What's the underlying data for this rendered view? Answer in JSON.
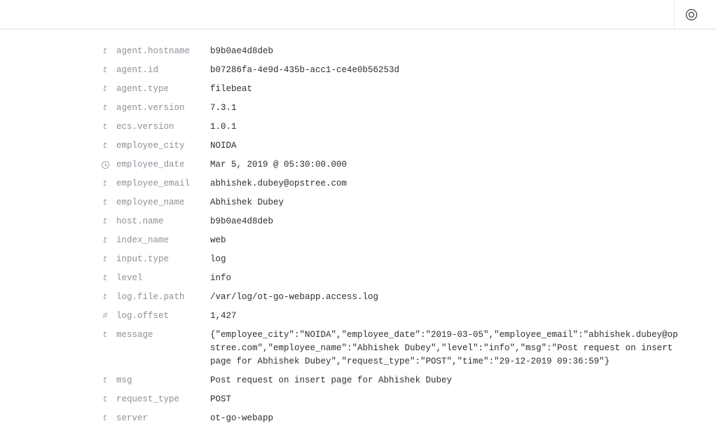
{
  "type_symbols": {
    "text": "t",
    "number": "#",
    "date": "clock"
  },
  "fields": [
    {
      "type": "text",
      "name": "agent.hostname",
      "value": "b9b0ae4d8deb"
    },
    {
      "type": "text",
      "name": "agent.id",
      "value": "b07286fa-4e9d-435b-acc1-ce4e0b56253d"
    },
    {
      "type": "text",
      "name": "agent.type",
      "value": "filebeat"
    },
    {
      "type": "text",
      "name": "agent.version",
      "value": "7.3.1"
    },
    {
      "type": "text",
      "name": "ecs.version",
      "value": "1.0.1"
    },
    {
      "type": "text",
      "name": "employee_city",
      "value": "NOIDA"
    },
    {
      "type": "date",
      "name": "employee_date",
      "value": "Mar 5, 2019 @ 05:30:00.000"
    },
    {
      "type": "text",
      "name": "employee_email",
      "value": "abhishek.dubey@opstree.com"
    },
    {
      "type": "text",
      "name": "employee_name",
      "value": "Abhishek Dubey"
    },
    {
      "type": "text",
      "name": "host.name",
      "value": "b9b0ae4d8deb"
    },
    {
      "type": "text",
      "name": "index_name",
      "value": "web"
    },
    {
      "type": "text",
      "name": "input.type",
      "value": "log"
    },
    {
      "type": "text",
      "name": "level",
      "value": "info"
    },
    {
      "type": "text",
      "name": "log.file.path",
      "value": "/var/log/ot-go-webapp.access.log"
    },
    {
      "type": "number",
      "name": "log.offset",
      "value": "1,427"
    },
    {
      "type": "text",
      "name": "message",
      "value": "{\"employee_city\":\"NOIDA\",\"employee_date\":\"2019-03-05\",\"employee_email\":\"abhishek.dubey@opstree.com\",\"employee_name\":\"Abhishek Dubey\",\"level\":\"info\",\"msg\":\"Post request on insert page for Abhishek Dubey\",\"request_type\":\"POST\",\"time\":\"29-12-2019 09:36:59\"}"
    },
    {
      "type": "text",
      "name": "msg",
      "value": "Post request on insert page for Abhishek Dubey"
    },
    {
      "type": "text",
      "name": "request_type",
      "value": "POST"
    },
    {
      "type": "text",
      "name": "server",
      "value": "ot-go-webapp"
    }
  ]
}
